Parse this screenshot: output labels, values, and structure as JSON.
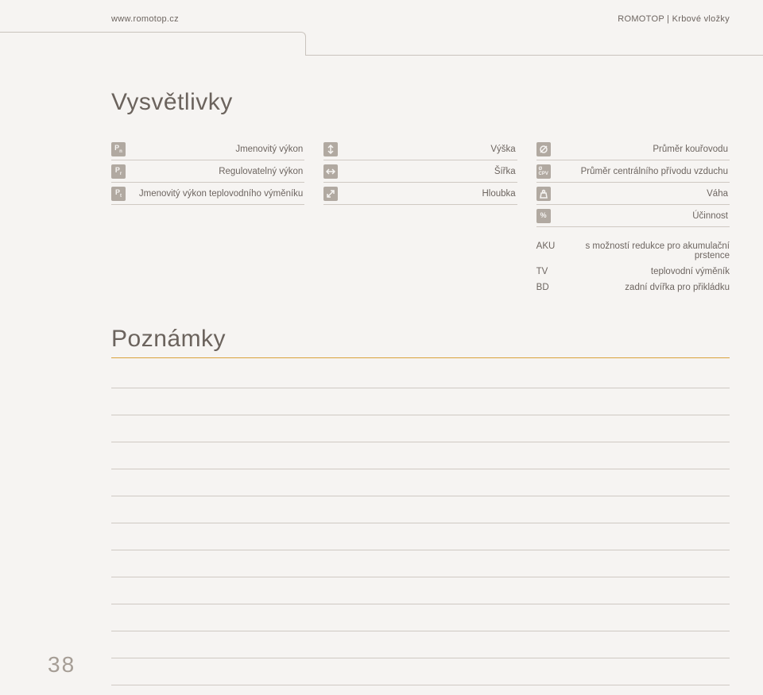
{
  "header": {
    "site": "www.romotop.cz",
    "section": "ROMOTOP | Krbové vložky"
  },
  "legend_title": "Vysvětlivky",
  "columns": [
    {
      "rows": [
        {
          "icon": "P_n",
          "label": "Jmenovitý výkon"
        },
        {
          "icon": "P_r",
          "label": "Regulovatelný výkon"
        },
        {
          "icon": "P_t",
          "label": "Jmenovitý výkon teplovodního výměníku"
        }
      ]
    },
    {
      "rows": [
        {
          "icon": "height",
          "label": "Výška"
        },
        {
          "icon": "width",
          "label": "Šířka"
        },
        {
          "icon": "depth",
          "label": "Hloubka"
        }
      ]
    },
    {
      "rows": [
        {
          "icon": "flue",
          "label": "Průměr kouřovodu"
        },
        {
          "icon": "cpv",
          "label": "Průměr centrálního přívodu vzduchu"
        },
        {
          "icon": "weight",
          "label": "Váha"
        },
        {
          "icon": "percent",
          "label": "Účinnost"
        }
      ]
    }
  ],
  "abbreviations": [
    {
      "code": "AKU",
      "desc": "s možností redukce pro akumulační prstence"
    },
    {
      "code": "TV",
      "desc": "teplovodní výměník"
    },
    {
      "code": "BD",
      "desc": "zadní dvířka pro přikládku"
    }
  ],
  "notes_title": "Poznámky",
  "notes_lines": 12,
  "page_number": "38"
}
